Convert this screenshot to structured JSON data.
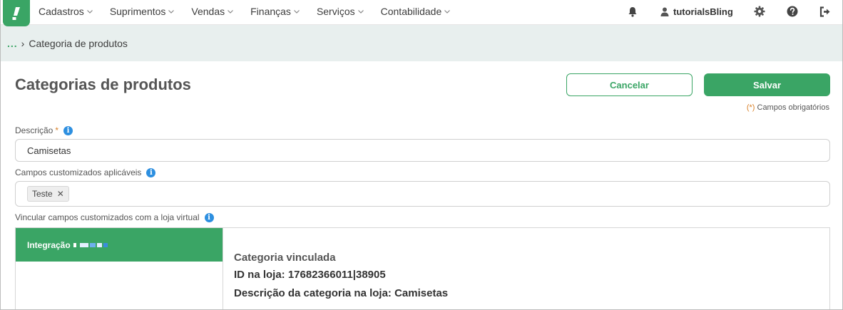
{
  "nav": {
    "menu": [
      {
        "label": "Cadastros"
      },
      {
        "label": "Suprimentos"
      },
      {
        "label": "Vendas"
      },
      {
        "label": "Finanças"
      },
      {
        "label": "Serviços"
      },
      {
        "label": "Contabilidade"
      }
    ],
    "user_name": "tutorialsBling",
    "icons": [
      "bell-icon",
      "user-icon",
      "gear-icon",
      "help-icon",
      "logout-icon"
    ]
  },
  "breadcrumb": {
    "ellipsis": "...",
    "separator": "›",
    "current": "Categoria de produtos"
  },
  "page": {
    "title": "Categorias de produtos",
    "cancel_label": "Cancelar",
    "save_label": "Salvar",
    "required_mark": "(*)",
    "required_note": "Campos obrigatórios"
  },
  "form": {
    "descricao_label": "Descrição",
    "descricao_required": "*",
    "descricao_value": "Camisetas",
    "campos_label": "Campos customizados aplicáveis",
    "campos_tags": [
      "Teste"
    ],
    "vincular_label": "Vincular campos customizados com a loja virtual"
  },
  "integration": {
    "tab_label": "Integração",
    "linked_title": "Categoria vinculada",
    "id_line": "ID na loja: 17682366011|38905",
    "desc_line": "Descrição da categoria na loja: Camisetas"
  },
  "colors": {
    "brand_green": "#3aa565",
    "info_blue": "#2d8fe0",
    "required_orange": "#d9822b",
    "breadcrumb_bg": "#e8efee"
  }
}
